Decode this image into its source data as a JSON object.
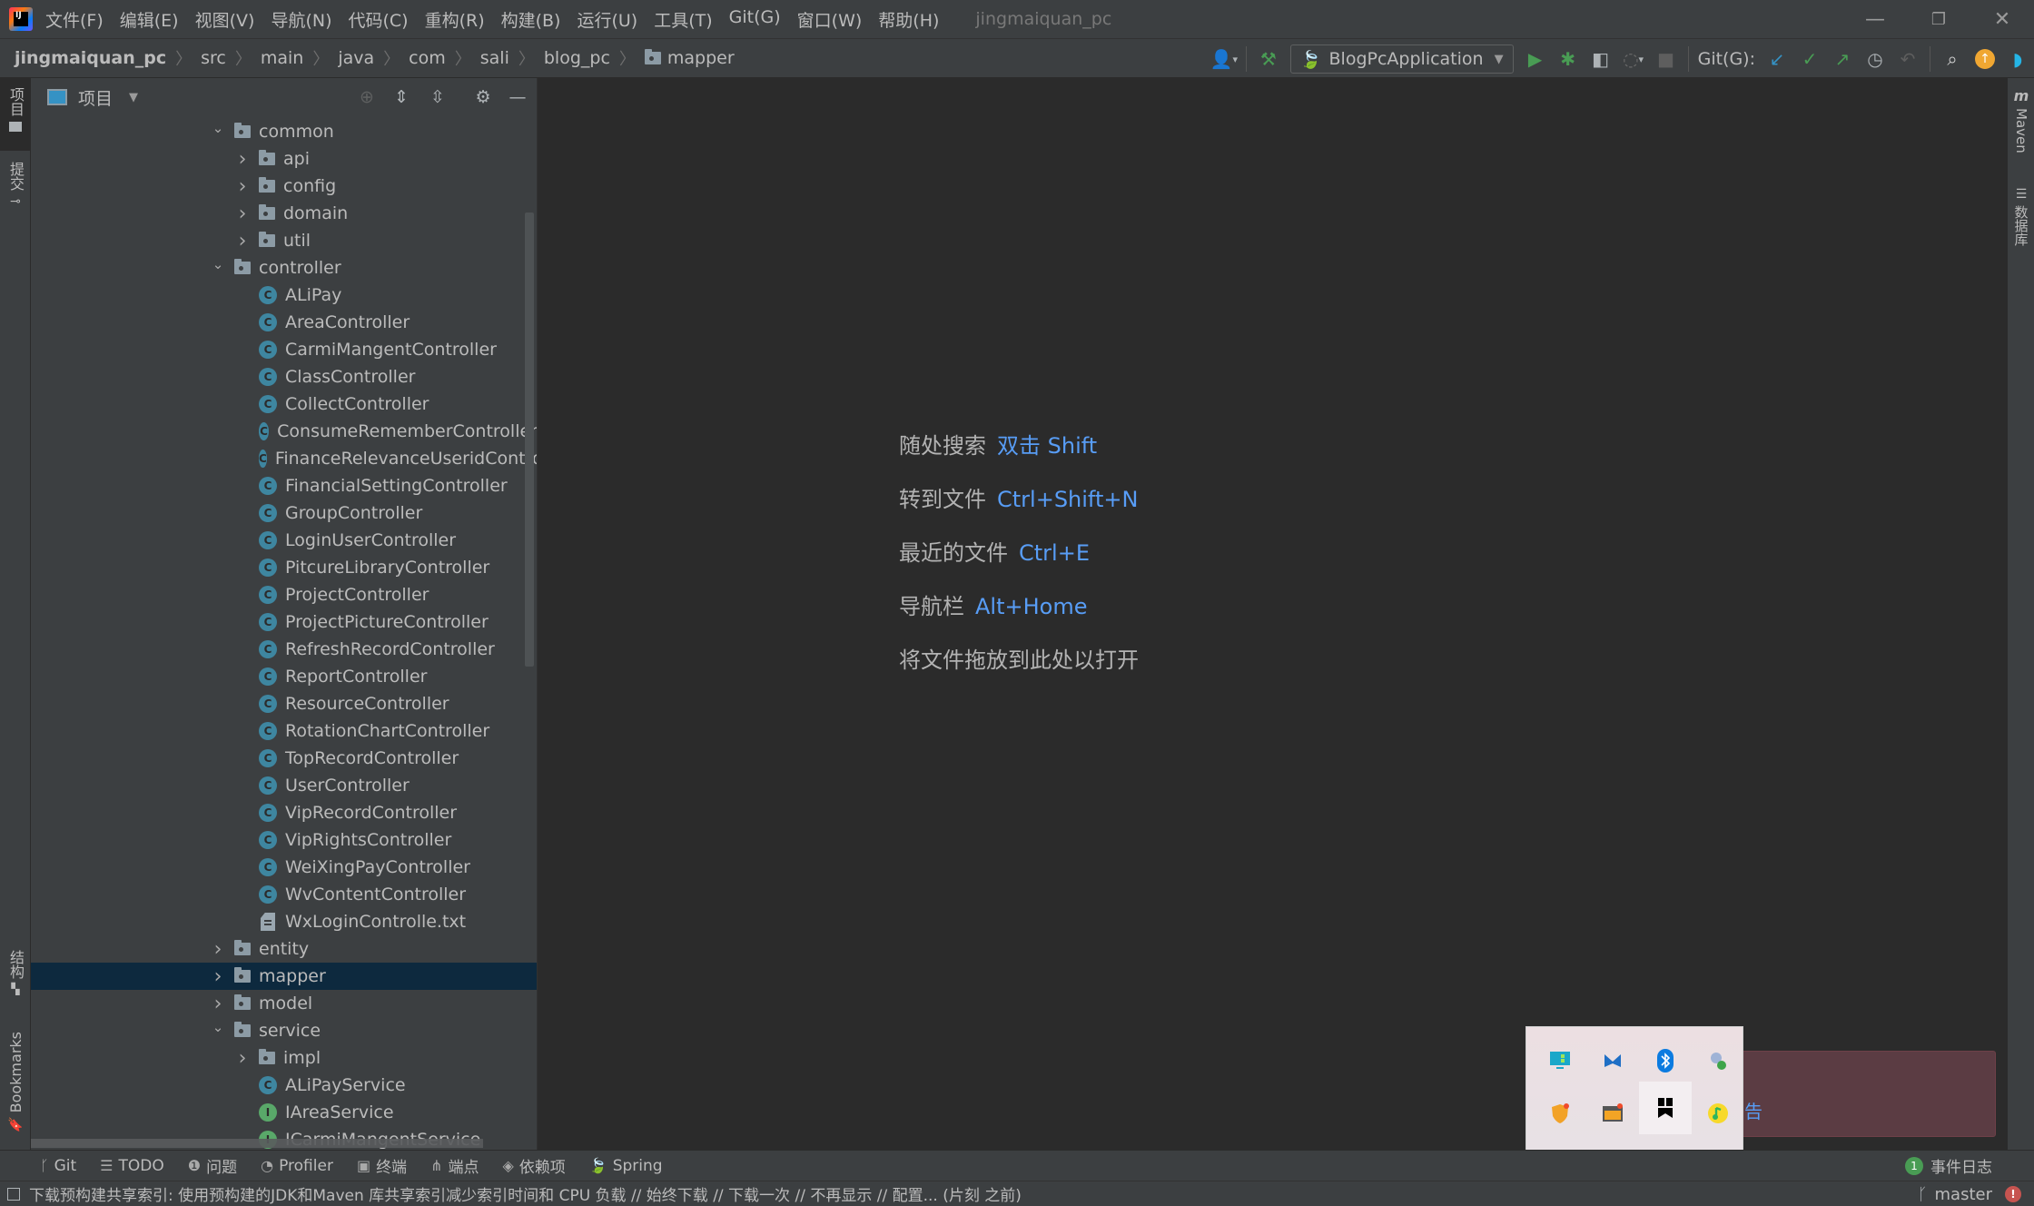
{
  "menu": {
    "items": [
      "文件(F)",
      "编辑(E)",
      "视图(V)",
      "导航(N)",
      "代码(C)",
      "重构(R)",
      "构建(B)",
      "运行(U)",
      "工具(T)",
      "Git(G)",
      "窗口(W)",
      "帮助(H)"
    ],
    "window_title": "jingmaiquan_pc"
  },
  "window_controls": {
    "minimize": "—",
    "restore": "❐",
    "close": "✕"
  },
  "breadcrumb": [
    "jingmaiquan_pc",
    "src",
    "main",
    "java",
    "com",
    "sali",
    "blog_pc",
    "mapper"
  ],
  "toolbar": {
    "run_config": "BlogPcApplication",
    "git_label": "Git(G):"
  },
  "left_strip": {
    "project_tab": "项目",
    "commit_tab": "提交",
    "structure_tab": "结构",
    "bookmarks_tab": "Bookmarks"
  },
  "right_strip": {
    "maven_tab": "Maven",
    "database_tab": "数据库"
  },
  "project_panel": {
    "title": "项目",
    "tree": [
      {
        "label": "common",
        "type": "folder",
        "depth": 0,
        "expanded": true
      },
      {
        "label": "api",
        "type": "folder",
        "depth": 1,
        "expanded": false
      },
      {
        "label": "config",
        "type": "folder",
        "depth": 1,
        "expanded": false
      },
      {
        "label": "domain",
        "type": "folder",
        "depth": 1,
        "expanded": false
      },
      {
        "label": "util",
        "type": "folder",
        "depth": 1,
        "expanded": false
      },
      {
        "label": "controller",
        "type": "folder",
        "depth": 0,
        "expanded": true
      },
      {
        "label": "ALiPay",
        "type": "class",
        "depth": 1
      },
      {
        "label": "AreaController",
        "type": "class",
        "depth": 1
      },
      {
        "label": "CarmiMangentController",
        "type": "class",
        "depth": 1
      },
      {
        "label": "ClassController",
        "type": "class",
        "depth": 1
      },
      {
        "label": "CollectController",
        "type": "class",
        "depth": 1
      },
      {
        "label": "ConsumeRememberController",
        "type": "class",
        "depth": 1
      },
      {
        "label": "FinanceRelevanceUseridControll",
        "type": "class",
        "depth": 1
      },
      {
        "label": "FinancialSettingController",
        "type": "class",
        "depth": 1
      },
      {
        "label": "GroupController",
        "type": "class",
        "depth": 1
      },
      {
        "label": "LoginUserController",
        "type": "class",
        "depth": 1
      },
      {
        "label": "PitcureLibraryController",
        "type": "class",
        "depth": 1
      },
      {
        "label": "ProjectController",
        "type": "class",
        "depth": 1
      },
      {
        "label": "ProjectPictureController",
        "type": "class",
        "depth": 1
      },
      {
        "label": "RefreshRecordController",
        "type": "class",
        "depth": 1
      },
      {
        "label": "ReportController",
        "type": "class",
        "depth": 1
      },
      {
        "label": "ResourceController",
        "type": "class",
        "depth": 1
      },
      {
        "label": "RotationChartController",
        "type": "class",
        "depth": 1
      },
      {
        "label": "TopRecordController",
        "type": "class",
        "depth": 1
      },
      {
        "label": "UserController",
        "type": "class",
        "depth": 1
      },
      {
        "label": "VipRecordController",
        "type": "class",
        "depth": 1
      },
      {
        "label": "VipRightsController",
        "type": "class",
        "depth": 1
      },
      {
        "label": "WeiXingPayController",
        "type": "class",
        "depth": 1
      },
      {
        "label": "WvContentController",
        "type": "class",
        "depth": 1
      },
      {
        "label": "WxLoginControlle.txt",
        "type": "text",
        "depth": 1
      },
      {
        "label": "entity",
        "type": "folder",
        "depth": 0,
        "expanded": false
      },
      {
        "label": "mapper",
        "type": "folder",
        "depth": 0,
        "expanded": false,
        "selected": true
      },
      {
        "label": "model",
        "type": "folder",
        "depth": 0,
        "expanded": false
      },
      {
        "label": "service",
        "type": "folder",
        "depth": 0,
        "expanded": true
      },
      {
        "label": "impl",
        "type": "folder",
        "depth": 1,
        "expanded": false
      },
      {
        "label": "ALiPayService",
        "type": "class",
        "depth": 1
      },
      {
        "label": "IAreaService",
        "type": "interface",
        "depth": 1
      },
      {
        "label": "ICarmiMangentService",
        "type": "interface",
        "depth": 1
      }
    ]
  },
  "editor": {
    "hints": [
      {
        "label": "随处搜索",
        "key": "双击 Shift"
      },
      {
        "label": "转到文件",
        "key": "Ctrl+Shift+N"
      },
      {
        "label": "最近的文件",
        "key": "Ctrl+E"
      },
      {
        "label": "导航栏",
        "key": "Alt+Home"
      },
      {
        "label": "将文件拖放到此处以打开",
        "key": ""
      }
    ]
  },
  "notification": {
    "partial_text": "告"
  },
  "tray_popup": {
    "icons": [
      "display-settings-icon",
      "app-blue-icon",
      "bluetooth-icon",
      "network-monitor-icon",
      "security-shield-icon",
      "window-app-icon",
      "bookmark-app-icon",
      "music-app-icon",
      "usb-drive-icon",
      "eye-care-icon"
    ]
  },
  "tool_windows": [
    {
      "label": "Git",
      "icon": "git-branch-icon"
    },
    {
      "label": "TODO",
      "icon": "list-icon"
    },
    {
      "label": "问题",
      "icon": "problems-icon"
    },
    {
      "label": "Profiler",
      "icon": "profiler-icon"
    },
    {
      "label": "终端",
      "icon": "terminal-icon"
    },
    {
      "label": "端点",
      "icon": "endpoints-icon"
    },
    {
      "label": "依赖项",
      "icon": "dependencies-icon"
    },
    {
      "label": "Spring",
      "icon": "spring-icon"
    }
  ],
  "event_log": {
    "count": "1",
    "label": "事件日志"
  },
  "status": {
    "message": "下载预构建共享索引: 使用预构建的JDK和Maven 库共享索引减少索引时间和 CPU 负载 // 始终下载 // 下载一次 // 不再显示 // 配置... (片刻 之前)",
    "branch": "master"
  }
}
